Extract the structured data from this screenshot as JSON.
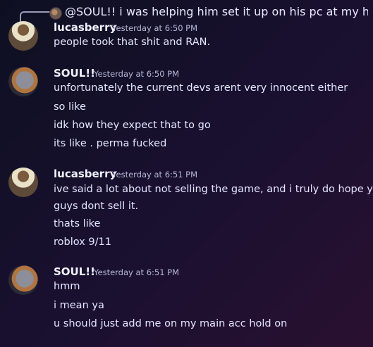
{
  "reply": {
    "text": "@SOUL!! i was helping him set it up on his pc at my house and we just L..."
  },
  "messages": [
    {
      "username": "lucasberry",
      "timestamp": "Yesterday at 6:50 PM",
      "lines": [
        "people took that shit and RAN."
      ]
    },
    {
      "username": "SOUL!!",
      "timestamp": "Yesterday at 6:50 PM",
      "lines": [
        "unfortunately the current devs arent very innocent either",
        "so like",
        "idk how they expect that to go",
        "its like . perma fucked"
      ]
    },
    {
      "username": "lucasberry",
      "timestamp": "Yesterday at 6:51 PM",
      "lines": [
        "ive said a lot about not selling the game, and i truly do hope you",
        "guys dont sell it.",
        "thats like",
        "roblox 9/11"
      ]
    },
    {
      "username": "SOUL!!",
      "timestamp": "Yesterday at 6:51 PM",
      "lines": [
        "hmm",
        "i mean ya",
        "u should just add me on my main acc hold on"
      ]
    }
  ]
}
